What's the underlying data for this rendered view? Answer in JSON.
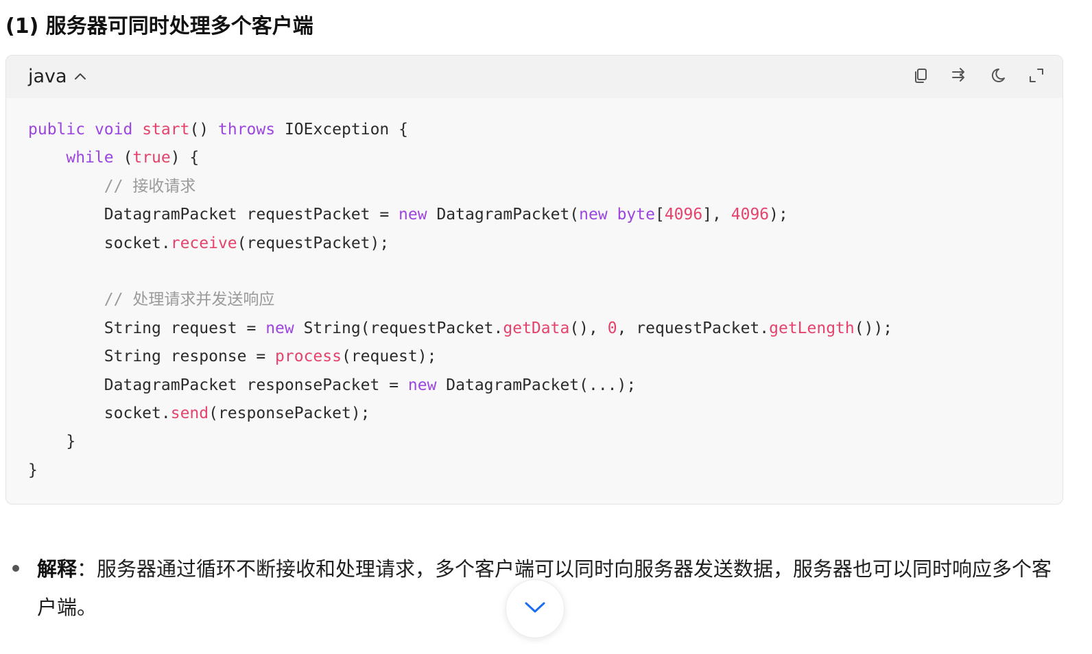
{
  "heading": "(1) 服务器可同时处理多个客户端",
  "code_block": {
    "language": "java",
    "actions": {
      "copy_icon": "copy-icon",
      "share_icon": "share-icon",
      "theme_icon": "moon-icon",
      "expand_icon": "expand-icon"
    },
    "lines": [
      [
        {
          "t": "public",
          "c": "kw"
        },
        {
          "t": " "
        },
        {
          "t": "void",
          "c": "kw"
        },
        {
          "t": " "
        },
        {
          "t": "start",
          "c": "fn"
        },
        {
          "t": "() "
        },
        {
          "t": "throws",
          "c": "kw"
        },
        {
          "t": " IOException {"
        }
      ],
      [
        {
          "t": "    "
        },
        {
          "t": "while",
          "c": "kw"
        },
        {
          "t": " ("
        },
        {
          "t": "true",
          "c": "fn"
        },
        {
          "t": ") {"
        }
      ],
      [
        {
          "t": "        "
        },
        {
          "t": "// 接收请求",
          "c": "cm"
        }
      ],
      [
        {
          "t": "        DatagramPacket requestPacket = "
        },
        {
          "t": "new",
          "c": "kw"
        },
        {
          "t": " DatagramPacket("
        },
        {
          "t": "new",
          "c": "kw"
        },
        {
          "t": " "
        },
        {
          "t": "byte",
          "c": "kw"
        },
        {
          "t": "["
        },
        {
          "t": "4096",
          "c": "num"
        },
        {
          "t": "], "
        },
        {
          "t": "4096",
          "c": "num"
        },
        {
          "t": ");"
        }
      ],
      [
        {
          "t": "        socket."
        },
        {
          "t": "receive",
          "c": "fn"
        },
        {
          "t": "(requestPacket);"
        }
      ],
      [
        {
          "t": ""
        }
      ],
      [
        {
          "t": "        "
        },
        {
          "t": "// 处理请求并发送响应",
          "c": "cm"
        }
      ],
      [
        {
          "t": "        String request = "
        },
        {
          "t": "new",
          "c": "kw"
        },
        {
          "t": " String(requestPacket."
        },
        {
          "t": "getData",
          "c": "fn"
        },
        {
          "t": "(), "
        },
        {
          "t": "0",
          "c": "num"
        },
        {
          "t": ", requestPacket."
        },
        {
          "t": "getLength",
          "c": "fn"
        },
        {
          "t": "());"
        }
      ],
      [
        {
          "t": "        String response = "
        },
        {
          "t": "process",
          "c": "fn"
        },
        {
          "t": "(request);"
        }
      ],
      [
        {
          "t": "        DatagramPacket responsePacket = "
        },
        {
          "t": "new",
          "c": "kw"
        },
        {
          "t": " DatagramPacket(...);"
        }
      ],
      [
        {
          "t": "        socket."
        },
        {
          "t": "send",
          "c": "fn"
        },
        {
          "t": "(responsePacket);"
        }
      ],
      [
        {
          "t": "    }"
        }
      ],
      [
        {
          "t": "}"
        }
      ]
    ]
  },
  "explanation": {
    "label": "解释",
    "separator": "：",
    "text": "服务器通过循环不断接收和处理请求，多个客户端可以同时向服务器发送数据，服务器也可以同时响应多个客户端。"
  },
  "scroll_button": {
    "icon": "chevron-down-icon"
  },
  "colors": {
    "keyword": "#9d45e0",
    "function": "#e5436b",
    "comment": "#9a9a9a",
    "accent": "#1a6cf0"
  }
}
